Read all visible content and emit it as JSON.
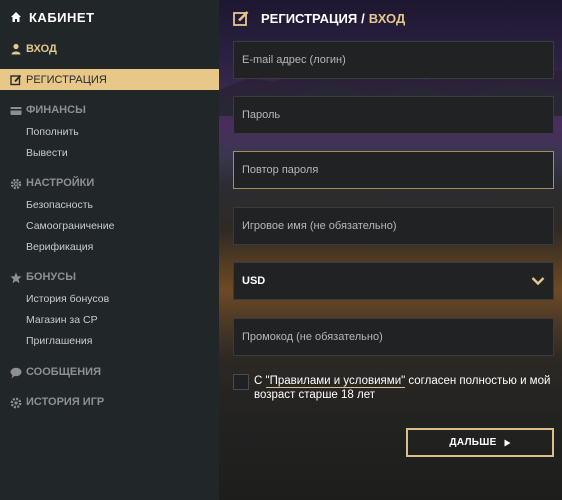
{
  "sidebar": {
    "brand_label": "КАБИНЕТ",
    "login_label": "ВХОД",
    "register_label": "РЕГИСТРАЦИЯ",
    "sections": {
      "finance": {
        "label": "ФИНАНСЫ",
        "items": [
          "Пополнить",
          "Вывести"
        ]
      },
      "settings": {
        "label": "НАСТРОЙКИ",
        "items": [
          "Безопасность",
          "Самоограничение",
          "Верификация"
        ]
      },
      "bonuses": {
        "label": "БОНУСЫ",
        "items": [
          "История бонусов",
          "Магазин за CP",
          "Приглашения"
        ]
      },
      "messages": {
        "label": "СООБЩЕНИЯ"
      },
      "history": {
        "label": "ИСТОРИЯ ИГР"
      }
    }
  },
  "main": {
    "title": "РЕГИСТРАЦИЯ",
    "title_separator": "/",
    "title_alt": "ВХОД",
    "fields": {
      "email_placeholder": "E-mail адрес (логин)",
      "password_placeholder": "Пароль",
      "password_repeat_placeholder": "Повтор пароля",
      "nickname_placeholder": "Игровое имя (не обязательно)",
      "currency_value": "USD",
      "promo_placeholder": "Промокод (не обязательно)"
    },
    "terms": {
      "prefix": "С ",
      "link": "\"Правилами и условиями\"",
      "suffix": " согласен полностью и мой возраст старше 18 лет"
    },
    "next_label": "ДАЛЬШЕ"
  },
  "colors": {
    "accent": "#e8c889",
    "sidebar_bg": "#212628",
    "field_bg": "#202224"
  },
  "icons": [
    "user-icon",
    "edit-icon",
    "wallet-icon",
    "gear-icon",
    "star-icon",
    "chat-icon",
    "history-icon",
    "chevron-down-icon",
    "arrow-right-icon"
  ]
}
